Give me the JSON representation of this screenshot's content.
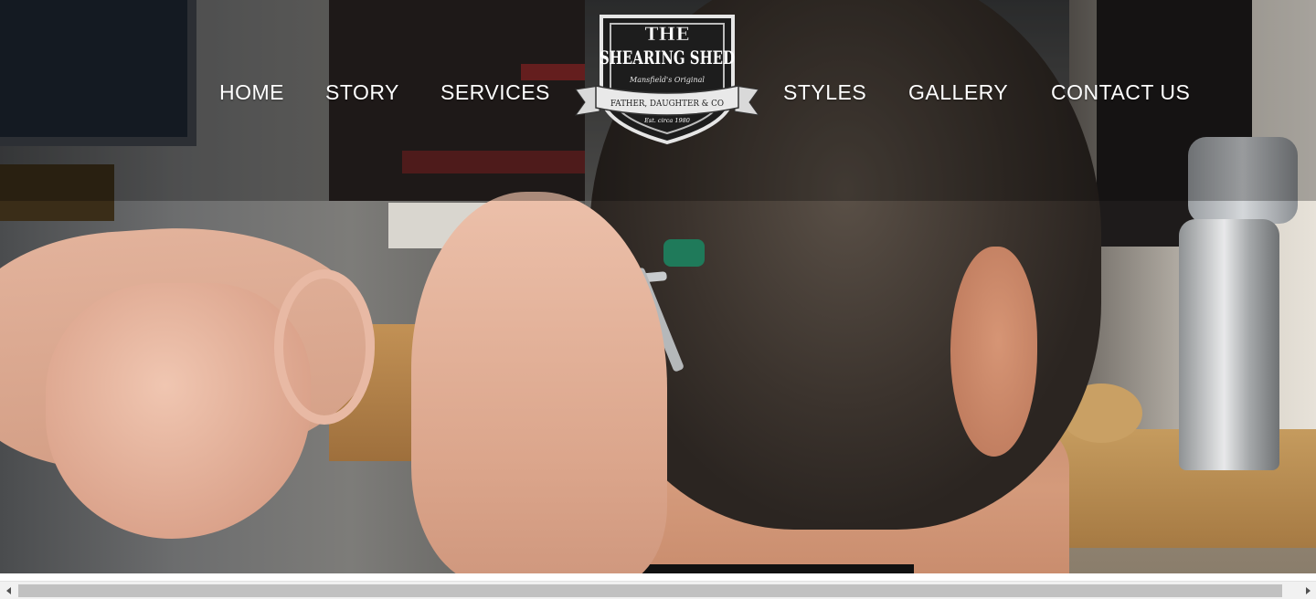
{
  "nav": {
    "home": "HOME",
    "story": "STORY",
    "services": "SERVICES",
    "styles": "STYLES",
    "gallery": "GALLERY",
    "contact": "CONTACT US"
  },
  "logo": {
    "line1": "THE",
    "line2": "SHEARING SHED",
    "tagline": "Mansfield's Original",
    "banner": "FATHER, DAUGHTER & CO",
    "established": "Est. circa 1980"
  },
  "hero": {
    "image": "barber-cutting-hair-photo"
  },
  "colors": {
    "nav_text": "#ffffff",
    "header_overlay": "rgba(0,0,0,0.28)",
    "scrollbar_track": "#f1f1f1",
    "scrollbar_thumb": "#c1c1c1"
  },
  "icons": {
    "scroll_left": "triangle-left-icon",
    "scroll_right": "triangle-right-icon"
  }
}
